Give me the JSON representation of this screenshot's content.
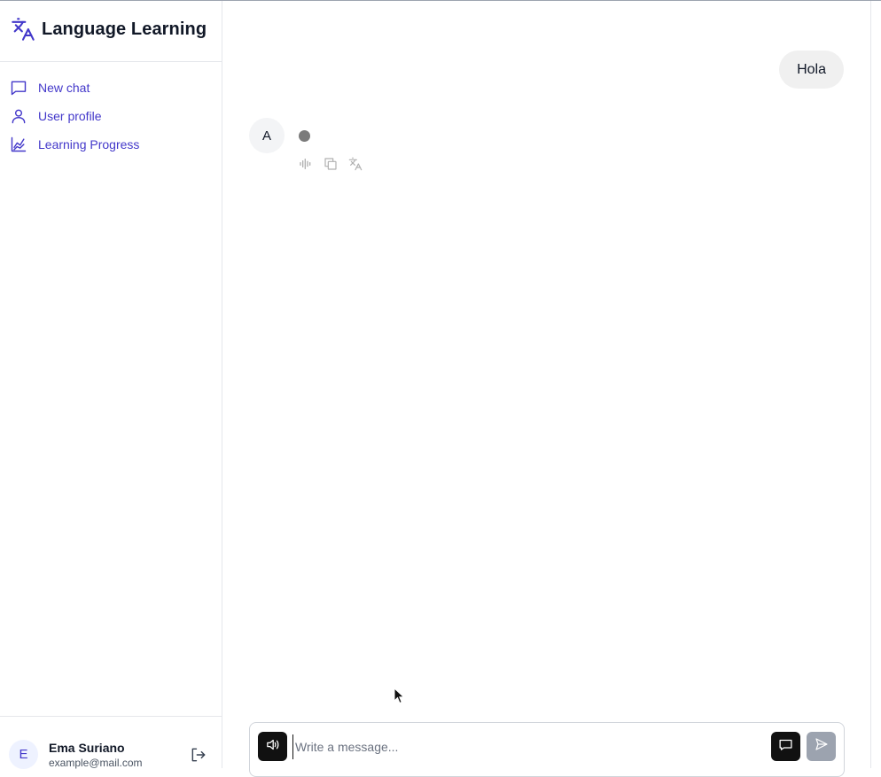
{
  "app": {
    "title": "Language Learning",
    "logo_icon": "translate-icon",
    "accent_color": "#4338ca"
  },
  "sidebar": {
    "items": [
      {
        "label": "New chat",
        "icon": "chat-bubble-icon"
      },
      {
        "label": "User profile",
        "icon": "user-icon"
      },
      {
        "label": "Learning Progress",
        "icon": "chart-line-icon"
      }
    ]
  },
  "user": {
    "initial": "E",
    "name": "Ema Suriano",
    "email": "example@mail.com",
    "logout_icon": "logout-icon"
  },
  "conversation": {
    "user_message": "Hola",
    "assistant_initial": "A",
    "assistant_status": "typing",
    "assistant_actions": [
      "audio-waveform-icon",
      "copy-icon",
      "translate-icon"
    ]
  },
  "composer": {
    "placeholder": "Write a message...",
    "value": "",
    "speaker_icon": "speaker-icon",
    "chat_icon": "chat-bubble-icon",
    "send_icon": "send-icon"
  }
}
